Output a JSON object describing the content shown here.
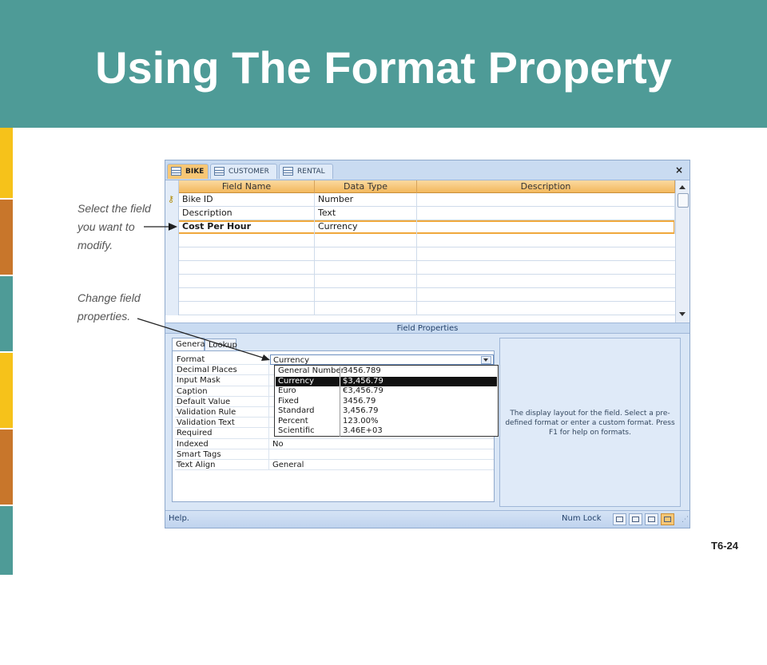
{
  "slide": {
    "title": "Using The Format Property",
    "slide_number": "T6-24",
    "colors": {
      "header": "#4e9b97",
      "stripe_yellow": "#f6c21a",
      "stripe_orange": "#c8762b",
      "stripe_teal": "#4e9b97"
    }
  },
  "annotations": {
    "select_field": "Select the field\nyou want to\nmodify.",
    "change_properties": "Change field\nproperties."
  },
  "window": {
    "tabs": [
      {
        "label": "BIKE",
        "icon": "table-icon"
      },
      {
        "label": "CUSTOMER",
        "icon": "table-icon"
      },
      {
        "label": "RENTAL",
        "icon": "table-icon"
      }
    ],
    "close_label": "×",
    "grid": {
      "columns": [
        "Field Name",
        "Data Type",
        "Description"
      ],
      "rows": [
        {
          "name": "Bike ID",
          "type": "Number",
          "description": "",
          "primary_key": true
        },
        {
          "name": "Description",
          "type": "Text",
          "description": ""
        },
        {
          "name": "Cost Per Hour",
          "type": "Currency",
          "description": "",
          "selected": true
        }
      ]
    },
    "field_properties_label": "Field Properties",
    "property_tabs": [
      "General",
      "Lookup"
    ],
    "properties": [
      {
        "name": "Format",
        "value": "Currency"
      },
      {
        "name": "Decimal Places",
        "value": ""
      },
      {
        "name": "Input Mask",
        "value": ""
      },
      {
        "name": "Caption",
        "value": ""
      },
      {
        "name": "Default Value",
        "value": ""
      },
      {
        "name": "Validation Rule",
        "value": ""
      },
      {
        "name": "Validation Text",
        "value": ""
      },
      {
        "name": "Required",
        "value": ""
      },
      {
        "name": "Indexed",
        "value": "No"
      },
      {
        "name": "Smart Tags",
        "value": ""
      },
      {
        "name": "Text Align",
        "value": "General"
      }
    ],
    "format_dropdown": {
      "selected": "Currency",
      "options": [
        {
          "name": "General Number",
          "sample": "3456.789"
        },
        {
          "name": "Currency",
          "sample": "$3,456.79"
        },
        {
          "name": "Euro",
          "sample": "€3,456.79"
        },
        {
          "name": "Fixed",
          "sample": "3456.79"
        },
        {
          "name": "Standard",
          "sample": "3,456.79"
        },
        {
          "name": "Percent",
          "sample": "123.00%"
        },
        {
          "name": "Scientific",
          "sample": "3.46E+03"
        }
      ]
    },
    "help_text": "The display layout for the field.  Select a pre-defined format or enter a custom format.  Press F1 for help on formats.",
    "status": {
      "left": "Help.",
      "numlock": "Num Lock",
      "view_buttons": [
        "datasheet-view-icon",
        "pivottable-view-icon",
        "pivotchart-view-icon",
        "design-view-icon"
      ]
    }
  }
}
